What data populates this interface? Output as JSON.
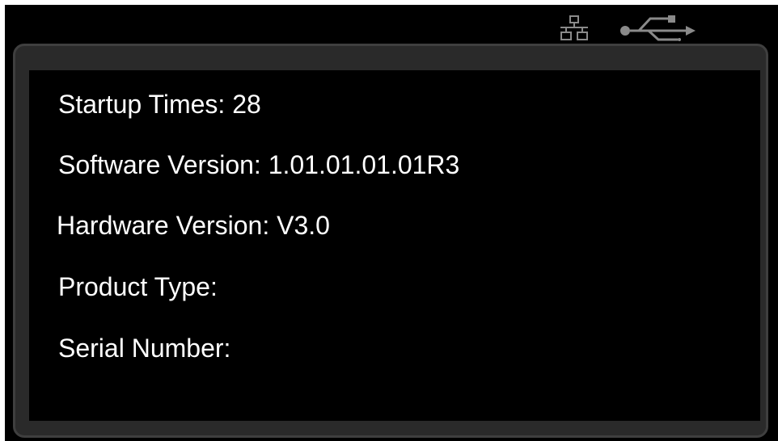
{
  "status_bar": {
    "icons": [
      "lan-icon",
      "usb-icon"
    ]
  },
  "info": {
    "startup_times": "Startup Times: 28",
    "software_version": "Software Version: 1.01.01.01.01R3",
    "hardware_version": "Hardware Version: V3.0",
    "product_type": "Product Type:",
    "serial_number": "Serial Number:"
  },
  "colors": {
    "background": "#000000",
    "panel_border": "#3f3f3f",
    "text": "#ffffff"
  }
}
